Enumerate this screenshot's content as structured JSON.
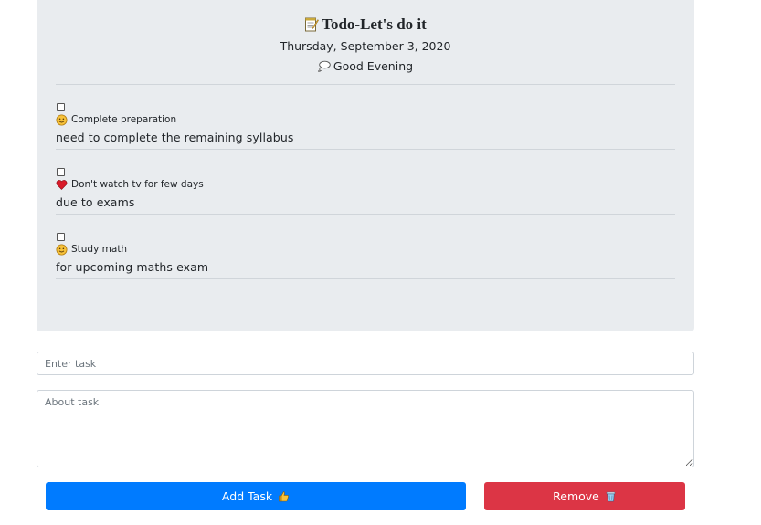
{
  "header": {
    "title": "Todo-Let's do it",
    "title_icon": "memo-icon",
    "date": "Thursday, September 3, 2020",
    "greeting": "Good Evening",
    "greeting_icon": "thought-bubble-icon"
  },
  "tasks": [
    {
      "title": "Complete preparation",
      "icon": "smiley-face-icon",
      "description": "need to complete the remaining syllabus",
      "checked": false
    },
    {
      "title": "Don't watch tv for few days",
      "icon": "heart-icon",
      "description": "due to exams",
      "checked": false
    },
    {
      "title": "Study math",
      "icon": "smiley-face-icon",
      "description": "for upcoming maths exam",
      "checked": false
    }
  ],
  "form": {
    "task_placeholder": "Enter task",
    "about_placeholder": "About task",
    "add_label": "Add Task",
    "add_icon": "thumbs-up-icon",
    "remove_label": "Remove",
    "remove_icon": "trash-can-icon"
  },
  "colors": {
    "panel": "#e9ecef",
    "primary": "#007bff",
    "danger": "#dc3545"
  }
}
